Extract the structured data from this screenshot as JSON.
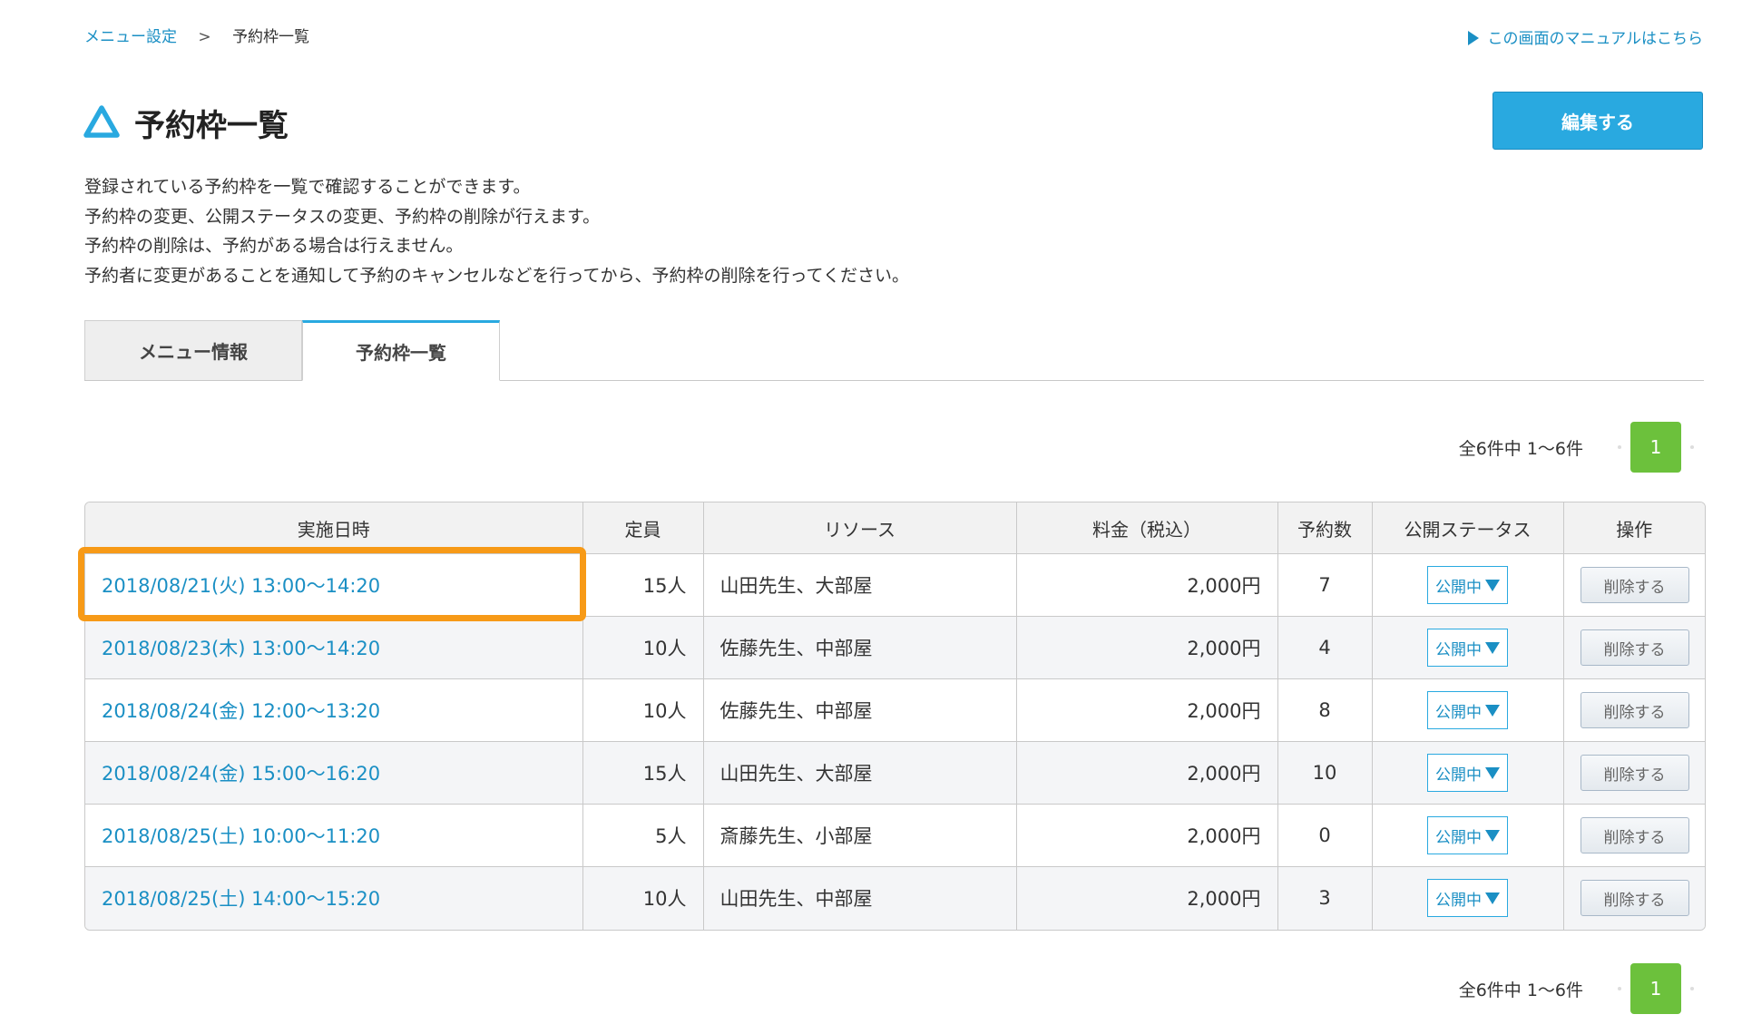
{
  "breadcrumb": {
    "parent": "メニュー設定",
    "separator": ">",
    "current": "予約枠一覧"
  },
  "manual_link": "この画面のマニュアルはこちら",
  "page_title": "予約枠一覧",
  "edit_button": "編集する",
  "description": [
    "登録されている予約枠を一覧で確認することができます。",
    "予約枠の変更、公開ステータスの変更、予約枠の削除が行えます。",
    "予約枠の削除は、予約がある場合は行えません。",
    "予約者に変更があることを通知して予約のキャンセルなどを行ってから、予約枠の削除を行ってください。"
  ],
  "tabs": [
    {
      "label": "メニュー情報",
      "active": false
    },
    {
      "label": "予約枠一覧",
      "active": true
    }
  ],
  "pagination": {
    "summary": "全6件中 1〜6件",
    "current_page": "1"
  },
  "table": {
    "headers": [
      "実施日時",
      "定員",
      "リソース",
      "料金（税込）",
      "予約数",
      "公開ステータス",
      "操作"
    ],
    "rows": [
      {
        "datetime": "2018/08/21(火) 13:00〜14:20",
        "capacity": "15人",
        "resource": "山田先生、大部屋",
        "price": "2,000円",
        "bookings": "7",
        "status": "公開中",
        "action": "削除する"
      },
      {
        "datetime": "2018/08/23(木) 13:00〜14:20",
        "capacity": "10人",
        "resource": "佐藤先生、中部屋",
        "price": "2,000円",
        "bookings": "4",
        "status": "公開中",
        "action": "削除する"
      },
      {
        "datetime": "2018/08/24(金) 12:00〜13:20",
        "capacity": "10人",
        "resource": "佐藤先生、中部屋",
        "price": "2,000円",
        "bookings": "8",
        "status": "公開中",
        "action": "削除する"
      },
      {
        "datetime": "2018/08/24(金) 15:00〜16:20",
        "capacity": "15人",
        "resource": "山田先生、大部屋",
        "price": "2,000円",
        "bookings": "10",
        "status": "公開中",
        "action": "削除する"
      },
      {
        "datetime": "2018/08/25(土) 10:00〜11:20",
        "capacity": "5人",
        "resource": "斎藤先生、小部屋",
        "price": "2,000円",
        "bookings": "0",
        "status": "公開中",
        "action": "削除する"
      },
      {
        "datetime": "2018/08/25(土) 14:00〜15:20",
        "capacity": "10人",
        "resource": "山田先生、中部屋",
        "price": "2,000円",
        "bookings": "3",
        "status": "公開中",
        "action": "削除する"
      }
    ]
  },
  "colors": {
    "accent": "#29a9e0",
    "link": "#1a8fc4",
    "page_active": "#6cc13c",
    "highlight": "#f79a17"
  }
}
